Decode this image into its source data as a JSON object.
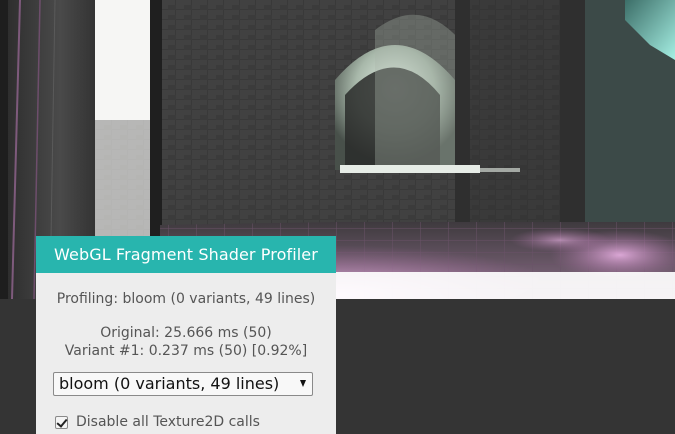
{
  "panel": {
    "title": "WebGL Fragment Shader Profiler",
    "profiling_status": "Profiling: bloom (0 variants, 49 lines)",
    "timing_original": "Original: 25.666 ms (50)",
    "timing_variant": "Variant #1: 0.237 ms (50) [0.92%]",
    "shader_select": {
      "selected": "bloom (0 variants, 49 lines)"
    },
    "disable_texture_checkbox": {
      "label": "Disable all Texture2D calls",
      "checked": true
    }
  },
  "colors": {
    "panel_header": "#28b5ae",
    "panel_background": "#ededed",
    "page_background": "#343434"
  }
}
